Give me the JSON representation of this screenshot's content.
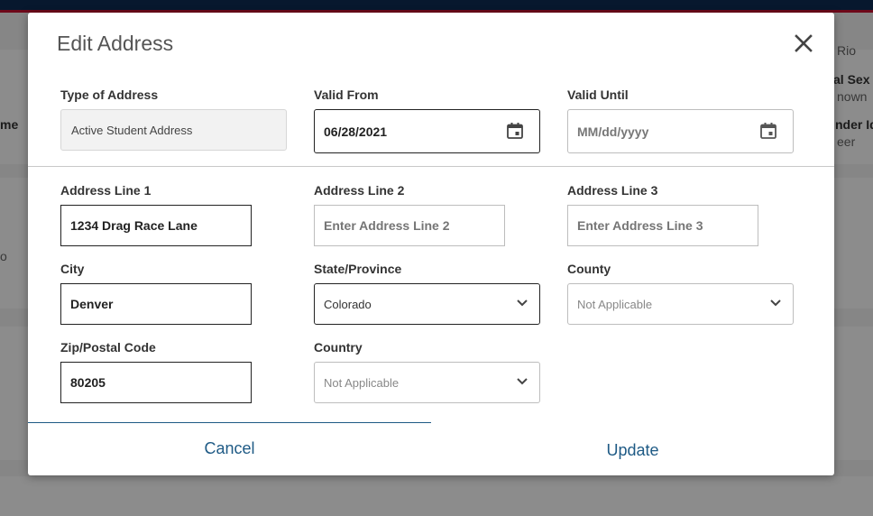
{
  "background": {
    "right_texts": [
      "Rio",
      "al Sex",
      "nown",
      "nder Id",
      "eer"
    ],
    "left_texts": [
      "me",
      "o"
    ]
  },
  "dialog": {
    "title": "Edit Address",
    "close_icon": "close-icon",
    "type_of_address": {
      "label": "Type of Address",
      "value": "Active Student Address"
    },
    "valid_from": {
      "label": "Valid From",
      "value": "06/28/2021",
      "icon": "calendar-icon"
    },
    "valid_until": {
      "label": "Valid Until",
      "placeholder": "MM/dd/yyyy",
      "icon": "calendar-icon"
    },
    "address_line_1": {
      "label": "Address Line 1",
      "value": "1234 Drag Race Lane"
    },
    "address_line_2": {
      "label": "Address Line 2",
      "placeholder": "Enter Address Line 2"
    },
    "address_line_3": {
      "label": "Address Line 3",
      "placeholder": "Enter Address Line 3"
    },
    "city": {
      "label": "City",
      "value": "Denver"
    },
    "state": {
      "label": "State/Province",
      "value": "Colorado",
      "icon": "chevron-down-icon"
    },
    "county": {
      "label": "County",
      "value": "Not Applicable",
      "icon": "chevron-down-icon"
    },
    "zip": {
      "label": "Zip/Postal Code",
      "value": "80205"
    },
    "country": {
      "label": "Country",
      "value": "Not Applicable",
      "icon": "chevron-down-icon"
    },
    "cancel_label": "Cancel",
    "update_label": "Update"
  },
  "colors": {
    "accent": "#1e5a85",
    "header_navy": "#0d2c54",
    "header_red": "#c8102e"
  }
}
